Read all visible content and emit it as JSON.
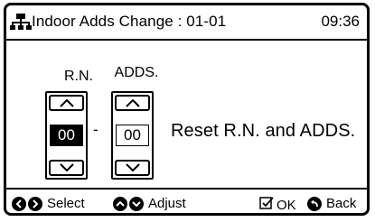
{
  "header": {
    "title": "Indoor Adds Change : 01-01",
    "time": "09:36",
    "icon": "network-icon"
  },
  "form": {
    "rn_label": "R.N.",
    "adds_label": "ADDS.",
    "rn_value": "00",
    "adds_value": "00",
    "separator": "-",
    "reset_text": "Reset R.N. and ADDS."
  },
  "footer": {
    "select_label": "Select",
    "adjust_label": "Adjust",
    "ok_label": "OK",
    "back_label": "Back"
  }
}
